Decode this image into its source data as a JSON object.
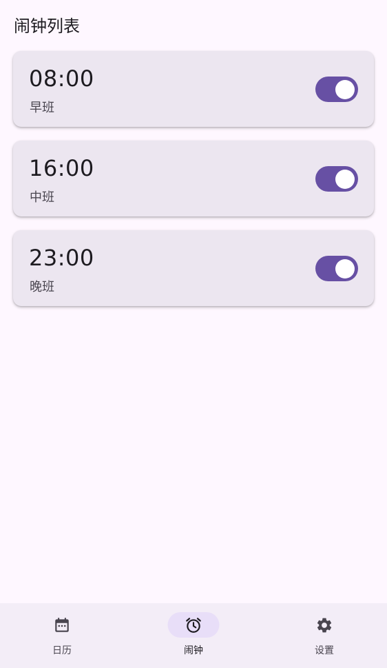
{
  "header": {
    "title": "闹钟列表"
  },
  "alarms": [
    {
      "time": "08:00",
      "label": "早班",
      "enabled": true
    },
    {
      "time": "16:00",
      "label": "中班",
      "enabled": true
    },
    {
      "time": "23:00",
      "label": "晚班",
      "enabled": true
    }
  ],
  "bottom_nav": {
    "active": "闹钟",
    "items": [
      {
        "label": "日历",
        "icon": "calendar-icon"
      },
      {
        "label": "闹钟",
        "icon": "alarm-clock-icon"
      },
      {
        "label": "设置",
        "icon": "gear-icon"
      }
    ]
  },
  "colors": {
    "background": "#fef7ff",
    "card": "#ece6f0",
    "accent": "#6750a4",
    "nav_background": "#f3edf7",
    "nav_active_pill": "#e8def8"
  }
}
